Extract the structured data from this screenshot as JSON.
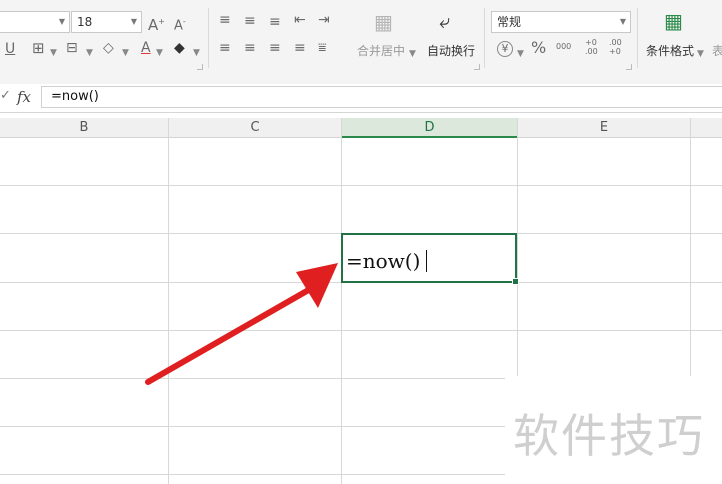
{
  "ribbon": {
    "font_size_value": "18",
    "number_format_value": "常规",
    "merge_center_label": "合并居中",
    "wrap_text_label": "自动换行",
    "conditional_format_label": "条件格式",
    "table_style_label_partial": "表",
    "currency_symbol": "¥",
    "percent_symbol": "%",
    "thousands_symbol": "000",
    "increase_decimal_symbol": "+0 .00",
    "decrease_decimal_symbol": ".00 +0"
  },
  "formula_bar": {
    "fx_label": "fx",
    "check_mark": "✓",
    "formula": "=now()"
  },
  "grid": {
    "columns": [
      "B",
      "C",
      "D",
      "E"
    ],
    "active_column": "D",
    "active_cell_text": "=now()"
  },
  "watermark": "软件技巧",
  "annotation": {
    "arrow_color": "#e02020"
  },
  "colors": {
    "accent_green": "#217346"
  }
}
